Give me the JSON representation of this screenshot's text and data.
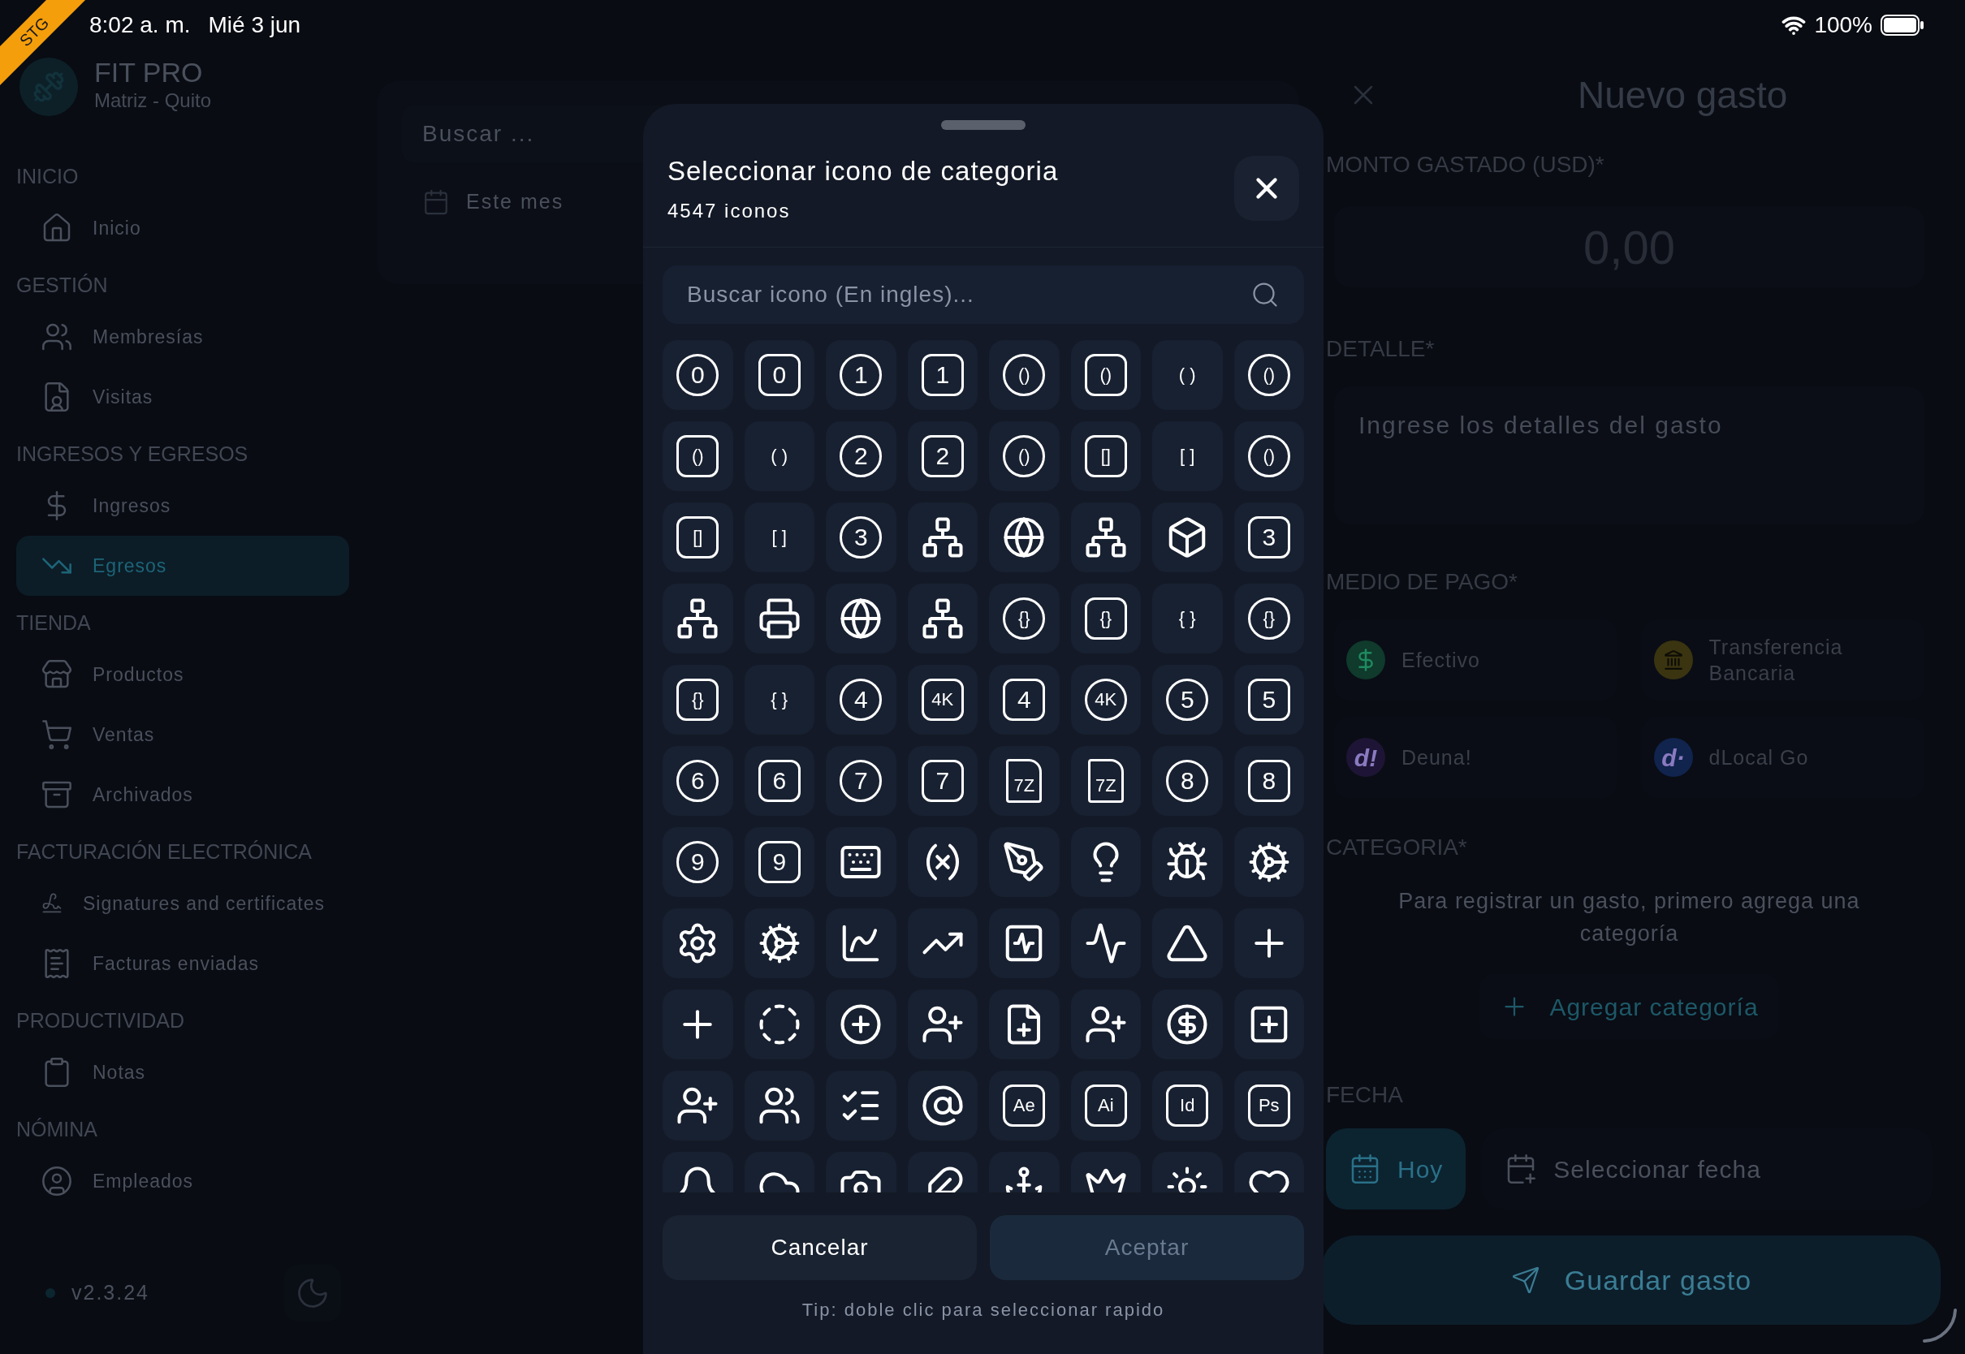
{
  "status_bar": {
    "banner": "STG",
    "time": "8:02 a. m.",
    "date": "Mié 3 jun",
    "battery": "100%"
  },
  "sidebar": {
    "brand": "FIT PRO",
    "branch": "Matriz - Quito",
    "sections": [
      {
        "title": "INICIO",
        "items": [
          {
            "label": "Inicio",
            "selected": false
          }
        ]
      },
      {
        "title": "GESTIÓN",
        "items": [
          {
            "label": "Membresías",
            "selected": false
          },
          {
            "label": "Visitas",
            "selected": false
          }
        ]
      },
      {
        "title": "INGRESOS Y EGRESOS",
        "items": [
          {
            "label": "Ingresos",
            "selected": false
          },
          {
            "label": "Egresos",
            "selected": true
          }
        ]
      },
      {
        "title": "TIENDA",
        "items": [
          {
            "label": "Productos",
            "selected": false
          },
          {
            "label": "Ventas",
            "selected": false
          },
          {
            "label": "Archivados",
            "selected": false
          }
        ]
      },
      {
        "title": "FACTURACIÓN ELECTRÓNICA",
        "items": [
          {
            "label": "Signatures and certificates",
            "selected": false
          },
          {
            "label": "Facturas enviadas",
            "selected": false
          }
        ]
      },
      {
        "title": "PRODUCTIVIDAD",
        "items": [
          {
            "label": "Notas",
            "selected": false
          }
        ]
      },
      {
        "title": "NÓMINA",
        "items": [
          {
            "label": "Empleados",
            "selected": false
          }
        ]
      }
    ],
    "version": "v2.3.24"
  },
  "list_panel": {
    "search": {
      "placeholder": "Buscar ..."
    },
    "filter": "Este mes"
  },
  "expense_form": {
    "title": "Nuevo gasto",
    "amount_label": "MONTO GASTADO (USD)*",
    "amount_placeholder": "0,00",
    "detail_label": "DETALLE*",
    "detail_placeholder": "Ingrese los detalles del gasto",
    "payment_label": "MEDIO DE PAGO*",
    "payment_methods": [
      {
        "label": "Efectivo",
        "kind": "icon",
        "color": "#0f3a2c"
      },
      {
        "label": "Transferencia Bancaria",
        "kind": "icon",
        "color": "#3b3410"
      },
      {
        "label": "Deuna!",
        "kind": "logo",
        "logo": "d!",
        "color": "#1e1536"
      },
      {
        "label": "dLocal Go",
        "kind": "logo",
        "logo": "d·",
        "color": "#10244e"
      }
    ],
    "category_label": "CATEGORIA*",
    "category_message": "Para registrar un gasto, primero agrega una categoría",
    "add_category": "Agregar categoría",
    "date_label": "FECHA",
    "date_options": [
      {
        "label": "Hoy",
        "selected": true
      },
      {
        "label": "Seleccionar fecha",
        "selected": false
      }
    ],
    "save_button": "Guardar gasto"
  },
  "icon_picker": {
    "title": "Seleccionar icono de categoria",
    "count": "4547 iconos",
    "search": {
      "placeholder": "Buscar icono (En ingles)..."
    },
    "icons": [
      {
        "kind": "circle",
        "glyph": "0"
      },
      {
        "kind": "square",
        "glyph": "0"
      },
      {
        "kind": "circle",
        "glyph": "1"
      },
      {
        "kind": "square",
        "glyph": "1"
      },
      {
        "kind": "circle",
        "glyph": "()"
      },
      {
        "kind": "square",
        "glyph": "()"
      },
      {
        "kind": "plain",
        "glyph": "( )"
      },
      {
        "kind": "circle",
        "glyph": "()"
      },
      {
        "kind": "square",
        "glyph": "()"
      },
      {
        "kind": "plain",
        "glyph": "( )"
      },
      {
        "kind": "circle",
        "glyph": "2"
      },
      {
        "kind": "square",
        "glyph": "2"
      },
      {
        "kind": "circle",
        "glyph": "()"
      },
      {
        "kind": "square",
        "glyph": "[]"
      },
      {
        "kind": "plain",
        "glyph": "[ ]"
      },
      {
        "kind": "circle",
        "glyph": "()"
      },
      {
        "kind": "square",
        "glyph": "[]"
      },
      {
        "kind": "plain",
        "glyph": "[ ]"
      },
      {
        "kind": "circle",
        "glyph": "3"
      },
      {
        "kind": "symbol"
      },
      {
        "kind": "symbol"
      },
      {
        "kind": "symbol"
      },
      {
        "kind": "symbol"
      },
      {
        "kind": "square",
        "glyph": "3"
      },
      {
        "kind": "symbol"
      },
      {
        "kind": "symbol"
      },
      {
        "kind": "symbol"
      },
      {
        "kind": "symbol"
      },
      {
        "kind": "circle",
        "glyph": "{}"
      },
      {
        "kind": "square",
        "glyph": "{}"
      },
      {
        "kind": "plain",
        "glyph": "{ }"
      },
      {
        "kind": "circle",
        "glyph": "{}"
      },
      {
        "kind": "square",
        "glyph": "{}"
      },
      {
        "kind": "plain",
        "glyph": "{ }"
      },
      {
        "kind": "circle",
        "glyph": "4"
      },
      {
        "kind": "square",
        "glyph": "4K"
      },
      {
        "kind": "square",
        "glyph": "4"
      },
      {
        "kind": "circle",
        "glyph": "4K"
      },
      {
        "kind": "circle",
        "glyph": "5"
      },
      {
        "kind": "square",
        "glyph": "5"
      },
      {
        "kind": "circle",
        "glyph": "6"
      },
      {
        "kind": "square",
        "glyph": "6"
      },
      {
        "kind": "circle",
        "glyph": "7"
      },
      {
        "kind": "square",
        "glyph": "7"
      },
      {
        "kind": "file",
        "glyph": "7Z"
      },
      {
        "kind": "file",
        "glyph": "7Z"
      },
      {
        "kind": "circle",
        "glyph": "8"
      },
      {
        "kind": "square",
        "glyph": "8"
      },
      {
        "kind": "circle",
        "glyph": "9"
      },
      {
        "kind": "square",
        "glyph": "9"
      },
      {
        "kind": "symbol"
      },
      {
        "kind": "symbol"
      },
      {
        "kind": "symbol"
      },
      {
        "kind": "symbol"
      },
      {
        "kind": "symbol"
      },
      {
        "kind": "symbol"
      },
      {
        "kind": "symbol"
      },
      {
        "kind": "symbol"
      },
      {
        "kind": "symbol"
      },
      {
        "kind": "symbol"
      },
      {
        "kind": "symbol"
      },
      {
        "kind": "symbol"
      },
      {
        "kind": "symbol"
      },
      {
        "kind": "symbol"
      },
      {
        "kind": "symbol"
      },
      {
        "kind": "symbol"
      },
      {
        "kind": "symbol"
      },
      {
        "kind": "symbol"
      },
      {
        "kind": "symbol"
      },
      {
        "kind": "symbol"
      },
      {
        "kind": "symbol"
      },
      {
        "kind": "symbol"
      },
      {
        "kind": "symbol"
      },
      {
        "kind": "symbol"
      },
      {
        "kind": "symbol"
      },
      {
        "kind": "symbol"
      },
      {
        "kind": "square",
        "glyph": "Ae"
      },
      {
        "kind": "square",
        "glyph": "Ai"
      },
      {
        "kind": "square",
        "glyph": "Id"
      },
      {
        "kind": "square",
        "glyph": "Ps"
      },
      {
        "kind": "symbol"
      },
      {
        "kind": "symbol"
      },
      {
        "kind": "symbol"
      },
      {
        "kind": "symbol"
      },
      {
        "kind": "symbol"
      },
      {
        "kind": "symbol"
      },
      {
        "kind": "symbol"
      },
      {
        "kind": "symbol"
      }
    ],
    "buttons": [
      {
        "label": "Cancelar",
        "disabled": false
      },
      {
        "label": "Aceptar",
        "disabled": true
      }
    ],
    "tip": "Tip: doble clic para seleccionar rapido"
  }
}
